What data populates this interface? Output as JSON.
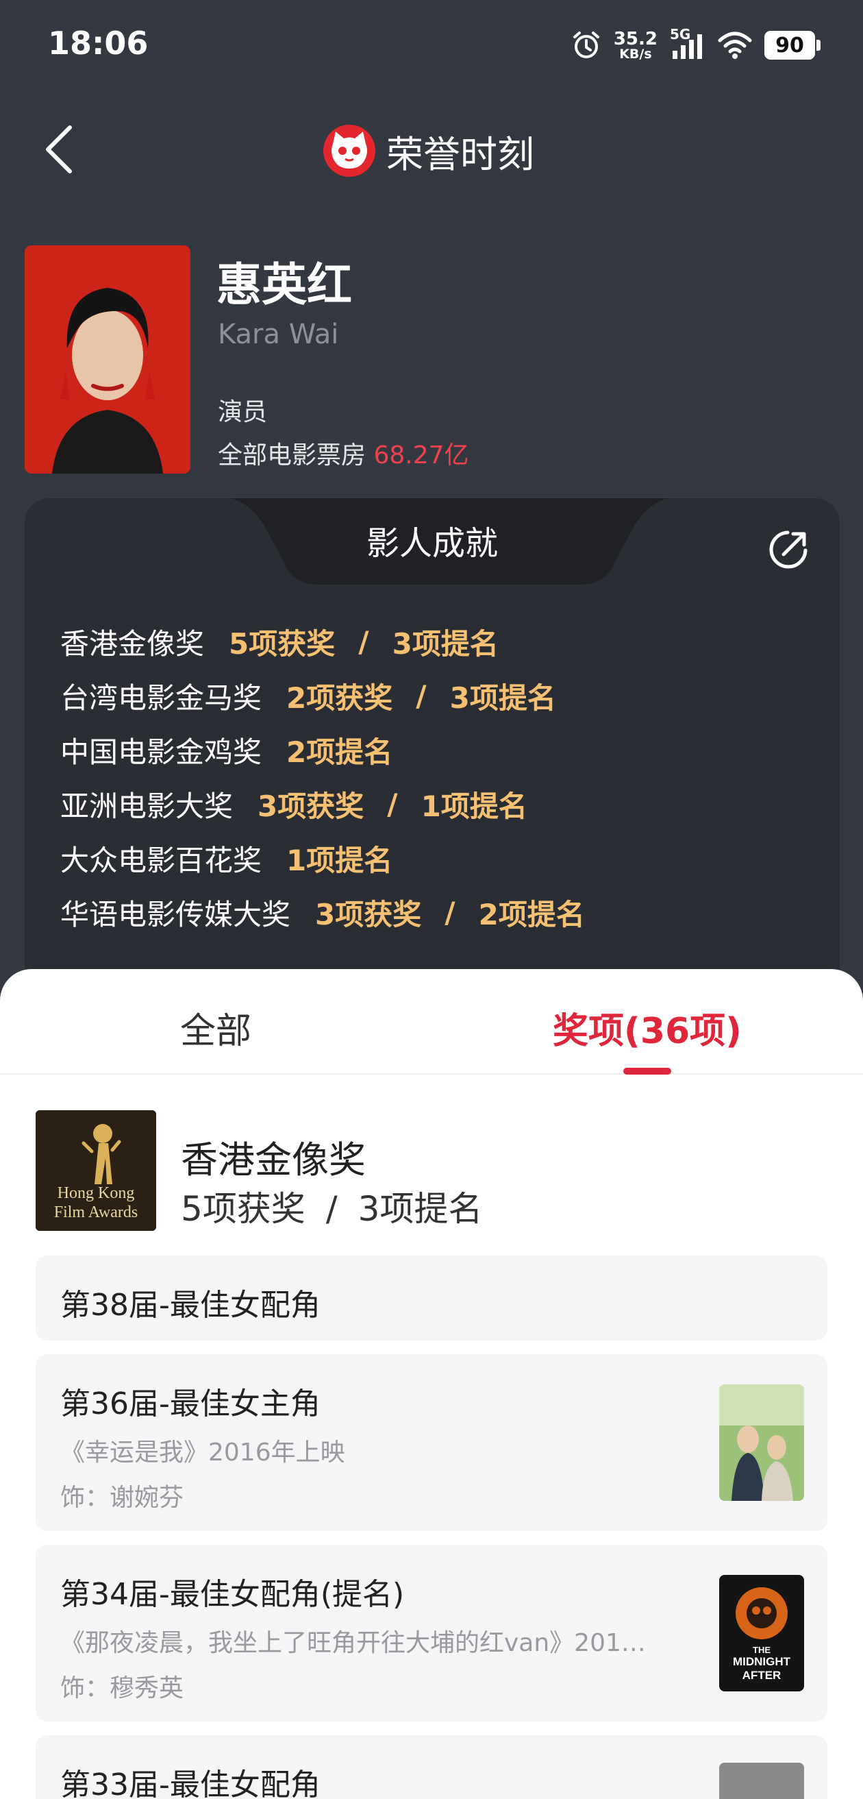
{
  "status_bar": {
    "time": "18:06",
    "net_speed_value": "35.2",
    "net_speed_unit": "KB/s",
    "network_type": "5G",
    "battery": "90"
  },
  "header": {
    "title": "荣誉时刻",
    "back_icon": "chevron-left-icon",
    "logo_icon": "maoyan-cat-logo-icon"
  },
  "profile": {
    "name": "惠英红",
    "english_name": "Kara Wai",
    "role": "演员",
    "box_office_label": "全部电影票房",
    "box_office_value": "68.27亿"
  },
  "achievements": {
    "title": "影人成就",
    "share_icon": "share-icon",
    "items": [
      {
        "award": "香港金像奖",
        "wins": "5项获奖",
        "noms": "3项提名"
      },
      {
        "award": "台湾电影金马奖",
        "wins": "2项获奖",
        "noms": "3项提名"
      },
      {
        "award": "中国电影金鸡奖",
        "wins": "",
        "noms": "2项提名"
      },
      {
        "award": "亚洲电影大奖",
        "wins": "3项获奖",
        "noms": "1项提名"
      },
      {
        "award": "大众电影百花奖",
        "wins": "",
        "noms": "1项提名"
      },
      {
        "award": "华语电影传媒大奖",
        "wins": "3项获奖",
        "noms": "2项提名"
      }
    ]
  },
  "tabs": {
    "all": "全部",
    "awards": "奖项(36项)"
  },
  "award_section": {
    "name": "香港金像奖",
    "logo_text_1": "Hong Kong",
    "logo_text_2": "Film Awards",
    "wins_num": "5",
    "wins_label": "项获奖",
    "separator": "/",
    "noms_num": "3",
    "noms_label": "项提名",
    "entries": [
      {
        "title": "第38届-最佳女配角"
      },
      {
        "title": "第36届-最佳女主角",
        "film": "《幸运是我》2016年上映",
        "role": "饰：谢婉芬"
      },
      {
        "title": "第34届-最佳女配角(提名)",
        "film": "《那夜凌晨，我坐上了旺角开往大埔的红van》201…",
        "role": "饰：穆秀英",
        "poster_text_1": "THE",
        "poster_text_2": "MIDNIGHT",
        "poster_text_3": "AFTER"
      },
      {
        "title": "第33届-最佳女配角"
      }
    ]
  },
  "colors": {
    "background": "#343840",
    "card": "#2a2d33",
    "gold": "#f6c072",
    "accent_red": "#e0263a",
    "box_office_red": "#f0404e"
  }
}
